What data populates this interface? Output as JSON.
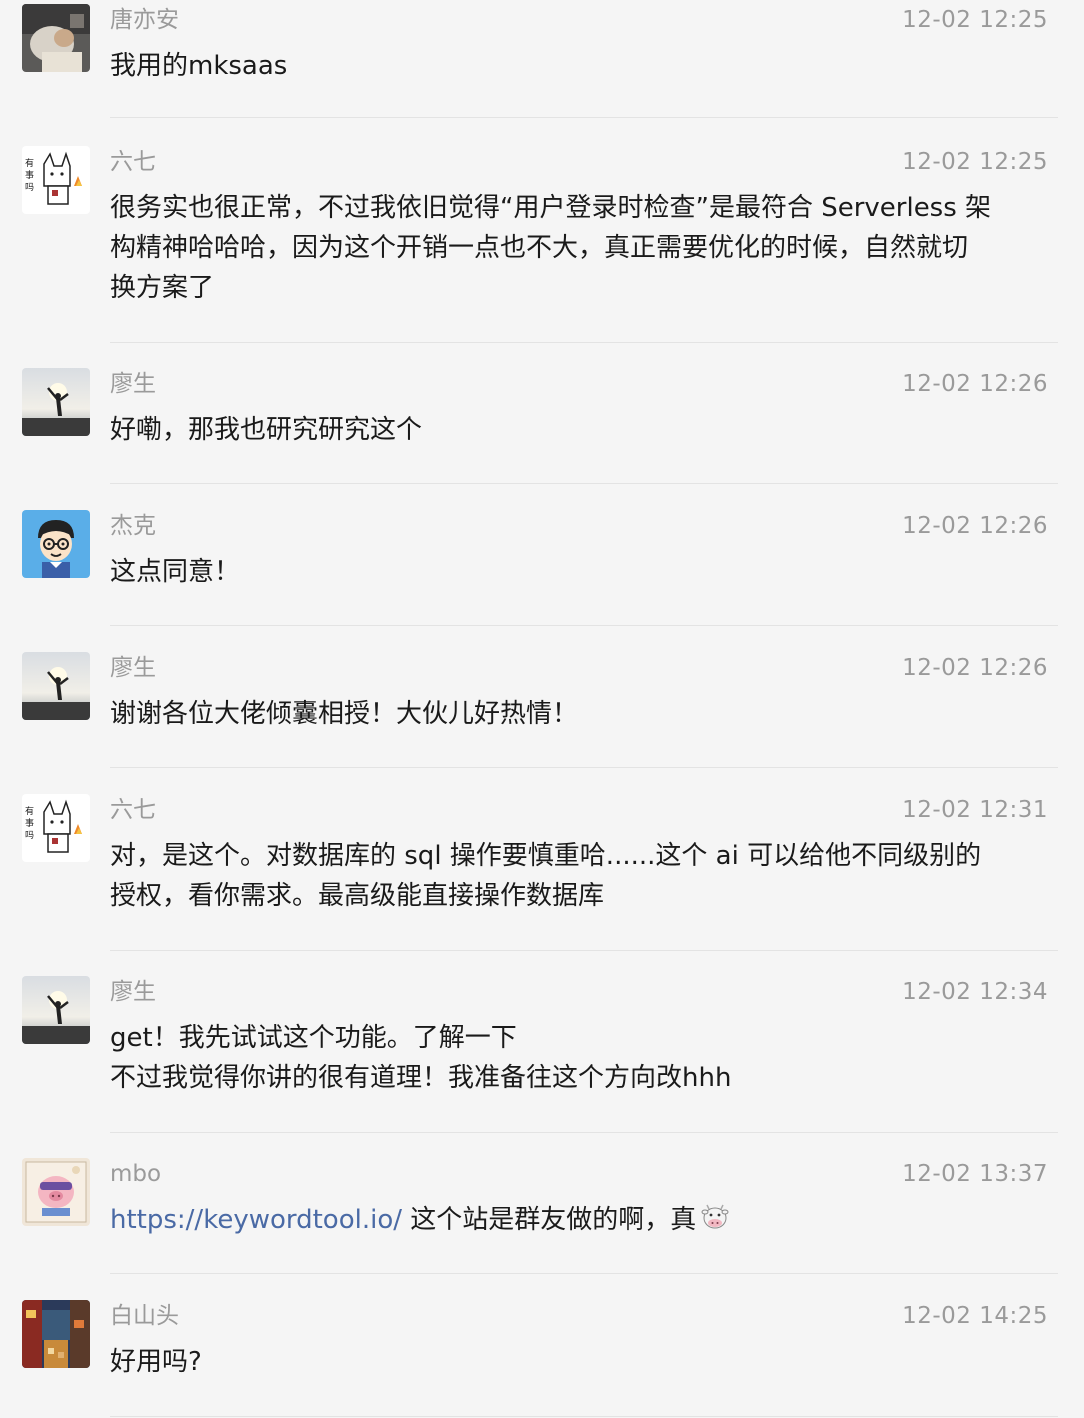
{
  "messages": [
    {
      "name": "唐亦安",
      "time": "12-02 12:25",
      "lines": [
        "我用的mksaas"
      ]
    },
    {
      "name": "六七",
      "time": "12-02 12:25",
      "lines": [
        "很务实也很正常，不过我依旧觉得“用户登录时检查”是最符合 Serverless 架",
        "构精神哈哈哈，因为这个开销一点也不大，真正需要优化的时候，自然就切",
        "换方案了"
      ]
    },
    {
      "name": "廖生",
      "time": "12-02 12:26",
      "lines": [
        "好嘞，那我也研究研究这个"
      ]
    },
    {
      "name": "杰克",
      "time": "12-02 12:26",
      "lines": [
        "这点同意！"
      ]
    },
    {
      "name": "廖生",
      "time": "12-02 12:26",
      "lines": [
        "谢谢各位大佬倾囊相授！大伙儿好热情！"
      ]
    },
    {
      "name": "六七",
      "time": "12-02 12:31",
      "lines": [
        "对，是这个。对数据库的 sql 操作要慎重哈......这个 ai 可以给他不同级别的",
        "授权，看你需求。最高级能直接操作数据库"
      ]
    },
    {
      "name": "廖生",
      "time": "12-02 12:34",
      "lines": [
        "get！我先试试这个功能。了解一下",
        "不过我觉得你讲的很有道理！我准备往这个方向改hhh"
      ]
    },
    {
      "name": "mbo",
      "time": "12-02 13:37",
      "link": "https://keywordtool.io/",
      "after_link": " 这个站是群友做的啊，真"
    },
    {
      "name": "白山头",
      "time": "12-02 14:25",
      "lines": [
        "好用吗?"
      ]
    }
  ],
  "colors": {
    "background": "#f5f5f5",
    "meta_text": "#9a9a9a",
    "body_text": "#1a1a1a",
    "link": "#4a6aa5",
    "divider": "#e3e3e3"
  },
  "icons": {
    "avatar_1": "photo-avatar",
    "avatar_2": "cartoon-fox-avatar",
    "avatar_3": "silhouette-sunset-avatar",
    "avatar_4": "cartoon-man-glasses-avatar",
    "avatar_8": "pig-sticker-avatar",
    "avatar_9": "painting-avatar",
    "emoji": "cow-face-icon"
  }
}
